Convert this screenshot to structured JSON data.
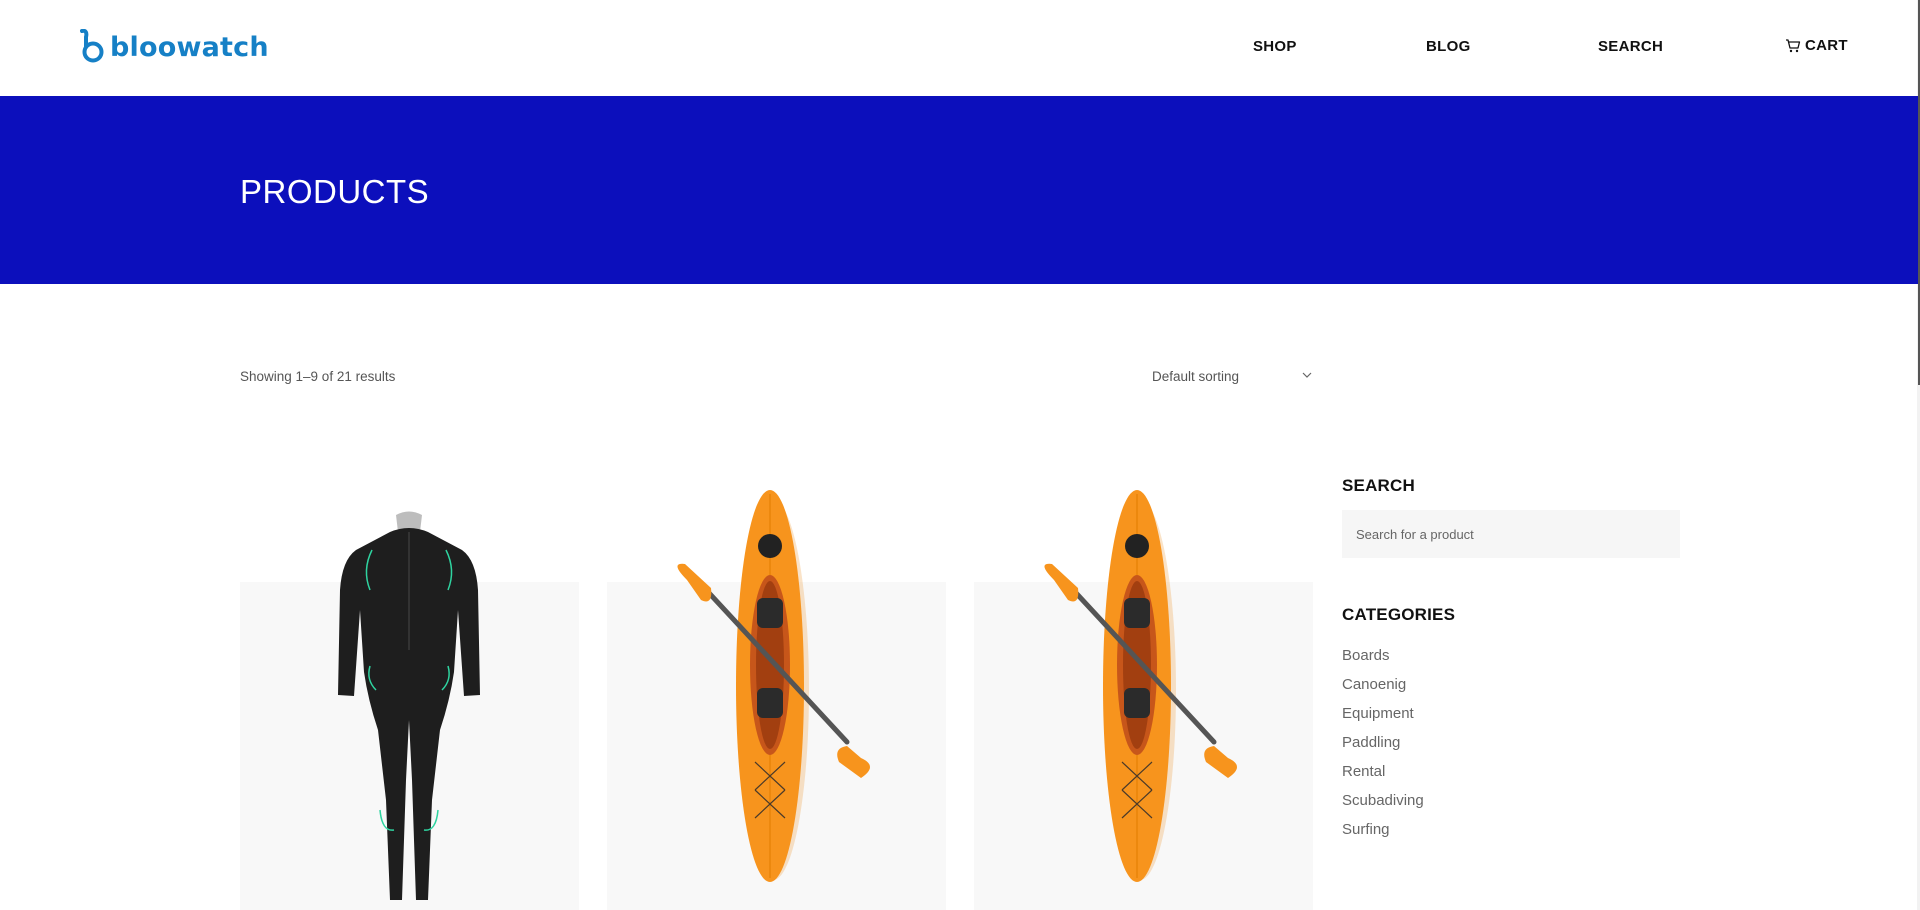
{
  "header": {
    "logo_text": "bloowatch",
    "nav": {
      "shop": "SHOP",
      "blog": "BLOG",
      "search": "SEARCH",
      "cart": "CART"
    }
  },
  "banner": {
    "title": "PRODUCTS",
    "background": "#0c0fbc"
  },
  "toolbar": {
    "result_count": "Showing 1–9 of 21 results",
    "sort_selected": "Default sorting"
  },
  "products": [
    {
      "image": "wetsuit-image"
    },
    {
      "image": "kayak-with-paddle-image"
    },
    {
      "image": "kayak-with-paddle-image"
    }
  ],
  "sidebar": {
    "search_title": "SEARCH",
    "search_placeholder": "Search for a product",
    "categories_title": "CATEGORIES",
    "categories": [
      "Boards",
      "Canoenig",
      "Equipment",
      "Paddling",
      "Rental",
      "Scubadiving",
      "Surfing"
    ]
  },
  "colors": {
    "brand": "#1680c6",
    "banner": "#0c0fbc",
    "kayak": "#f7941d"
  }
}
